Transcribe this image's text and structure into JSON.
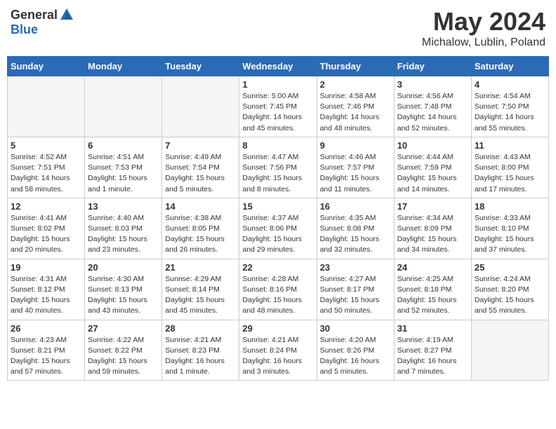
{
  "header": {
    "logo_general": "General",
    "logo_blue": "Blue",
    "month_title": "May 2024",
    "location": "Michalow, Lublin, Poland"
  },
  "calendar": {
    "days_of_week": [
      "Sunday",
      "Monday",
      "Tuesday",
      "Wednesday",
      "Thursday",
      "Friday",
      "Saturday"
    ],
    "weeks": [
      [
        {
          "day": "",
          "info": ""
        },
        {
          "day": "",
          "info": ""
        },
        {
          "day": "",
          "info": ""
        },
        {
          "day": "1",
          "info": "Sunrise: 5:00 AM\nSunset: 7:45 PM\nDaylight: 14 hours\nand 45 minutes."
        },
        {
          "day": "2",
          "info": "Sunrise: 4:58 AM\nSunset: 7:46 PM\nDaylight: 14 hours\nand 48 minutes."
        },
        {
          "day": "3",
          "info": "Sunrise: 4:56 AM\nSunset: 7:48 PM\nDaylight: 14 hours\nand 52 minutes."
        },
        {
          "day": "4",
          "info": "Sunrise: 4:54 AM\nSunset: 7:50 PM\nDaylight: 14 hours\nand 55 minutes."
        }
      ],
      [
        {
          "day": "5",
          "info": "Sunrise: 4:52 AM\nSunset: 7:51 PM\nDaylight: 14 hours\nand 58 minutes."
        },
        {
          "day": "6",
          "info": "Sunrise: 4:51 AM\nSunset: 7:53 PM\nDaylight: 15 hours\nand 1 minute."
        },
        {
          "day": "7",
          "info": "Sunrise: 4:49 AM\nSunset: 7:54 PM\nDaylight: 15 hours\nand 5 minutes."
        },
        {
          "day": "8",
          "info": "Sunrise: 4:47 AM\nSunset: 7:56 PM\nDaylight: 15 hours\nand 8 minutes."
        },
        {
          "day": "9",
          "info": "Sunrise: 4:46 AM\nSunset: 7:57 PM\nDaylight: 15 hours\nand 11 minutes."
        },
        {
          "day": "10",
          "info": "Sunrise: 4:44 AM\nSunset: 7:59 PM\nDaylight: 15 hours\nand 14 minutes."
        },
        {
          "day": "11",
          "info": "Sunrise: 4:43 AM\nSunset: 8:00 PM\nDaylight: 15 hours\nand 17 minutes."
        }
      ],
      [
        {
          "day": "12",
          "info": "Sunrise: 4:41 AM\nSunset: 8:02 PM\nDaylight: 15 hours\nand 20 minutes."
        },
        {
          "day": "13",
          "info": "Sunrise: 4:40 AM\nSunset: 8:03 PM\nDaylight: 15 hours\nand 23 minutes."
        },
        {
          "day": "14",
          "info": "Sunrise: 4:38 AM\nSunset: 8:05 PM\nDaylight: 15 hours\nand 26 minutes."
        },
        {
          "day": "15",
          "info": "Sunrise: 4:37 AM\nSunset: 8:06 PM\nDaylight: 15 hours\nand 29 minutes."
        },
        {
          "day": "16",
          "info": "Sunrise: 4:35 AM\nSunset: 8:08 PM\nDaylight: 15 hours\nand 32 minutes."
        },
        {
          "day": "17",
          "info": "Sunrise: 4:34 AM\nSunset: 8:09 PM\nDaylight: 15 hours\nand 34 minutes."
        },
        {
          "day": "18",
          "info": "Sunrise: 4:33 AM\nSunset: 8:10 PM\nDaylight: 15 hours\nand 37 minutes."
        }
      ],
      [
        {
          "day": "19",
          "info": "Sunrise: 4:31 AM\nSunset: 8:12 PM\nDaylight: 15 hours\nand 40 minutes."
        },
        {
          "day": "20",
          "info": "Sunrise: 4:30 AM\nSunset: 8:13 PM\nDaylight: 15 hours\nand 43 minutes."
        },
        {
          "day": "21",
          "info": "Sunrise: 4:29 AM\nSunset: 8:14 PM\nDaylight: 15 hours\nand 45 minutes."
        },
        {
          "day": "22",
          "info": "Sunrise: 4:28 AM\nSunset: 8:16 PM\nDaylight: 15 hours\nand 48 minutes."
        },
        {
          "day": "23",
          "info": "Sunrise: 4:27 AM\nSunset: 8:17 PM\nDaylight: 15 hours\nand 50 minutes."
        },
        {
          "day": "24",
          "info": "Sunrise: 4:25 AM\nSunset: 8:18 PM\nDaylight: 15 hours\nand 52 minutes."
        },
        {
          "day": "25",
          "info": "Sunrise: 4:24 AM\nSunset: 8:20 PM\nDaylight: 15 hours\nand 55 minutes."
        }
      ],
      [
        {
          "day": "26",
          "info": "Sunrise: 4:23 AM\nSunset: 8:21 PM\nDaylight: 15 hours\nand 57 minutes."
        },
        {
          "day": "27",
          "info": "Sunrise: 4:22 AM\nSunset: 8:22 PM\nDaylight: 15 hours\nand 59 minutes."
        },
        {
          "day": "28",
          "info": "Sunrise: 4:21 AM\nSunset: 8:23 PM\nDaylight: 16 hours\nand 1 minute."
        },
        {
          "day": "29",
          "info": "Sunrise: 4:21 AM\nSunset: 8:24 PM\nDaylight: 16 hours\nand 3 minutes."
        },
        {
          "day": "30",
          "info": "Sunrise: 4:20 AM\nSunset: 8:26 PM\nDaylight: 16 hours\nand 5 minutes."
        },
        {
          "day": "31",
          "info": "Sunrise: 4:19 AM\nSunset: 8:27 PM\nDaylight: 16 hours\nand 7 minutes."
        },
        {
          "day": "",
          "info": ""
        }
      ]
    ]
  }
}
